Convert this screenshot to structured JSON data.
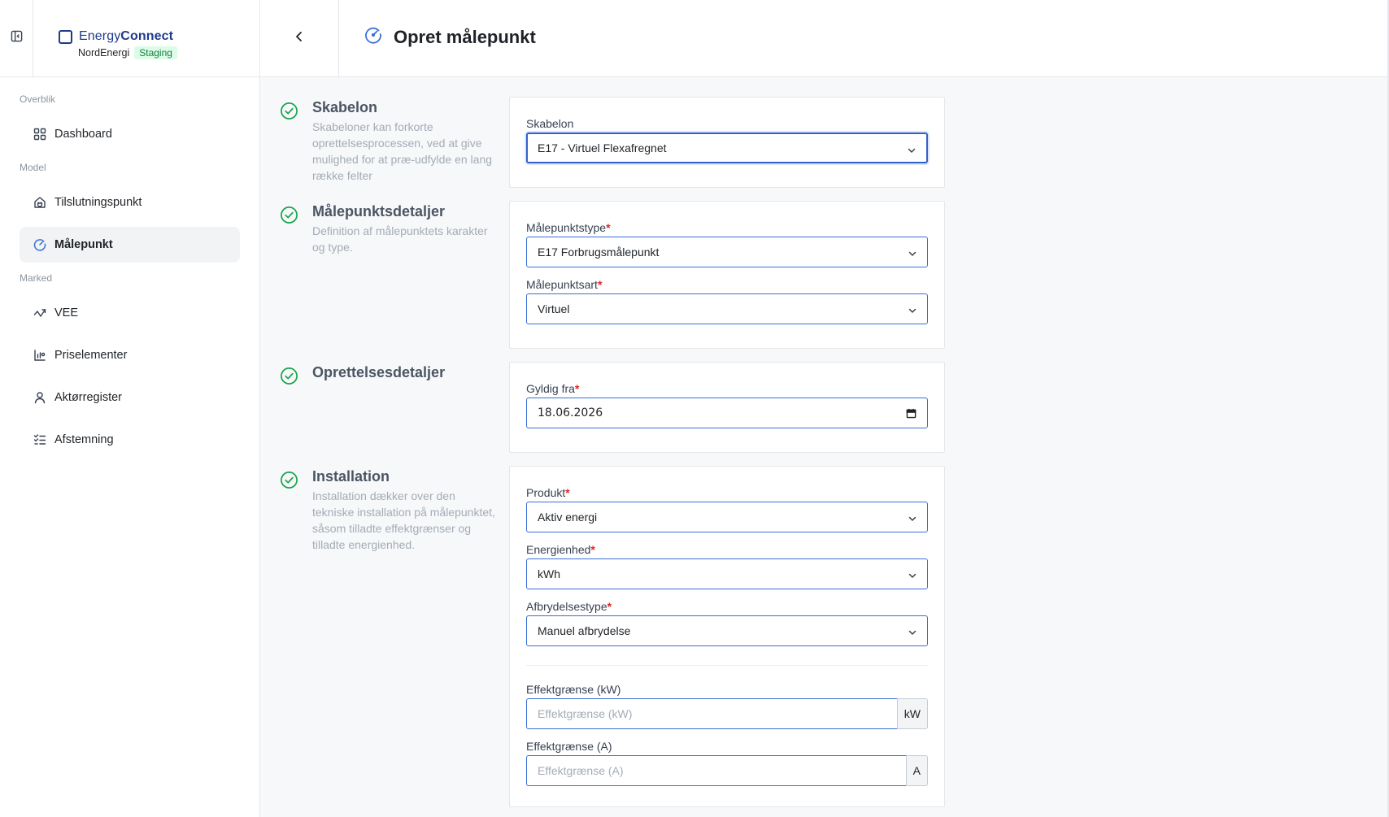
{
  "header": {
    "brand_light": "Energy",
    "brand_bold": "Connect",
    "org": "NordEnergi",
    "env_badge": "Staging",
    "page_title": "Opret målepunkt"
  },
  "sidebar": {
    "sections": [
      {
        "label": "Overblik"
      },
      {
        "label": "Model"
      },
      {
        "label": "Marked"
      }
    ],
    "items": [
      {
        "label": "Dashboard",
        "icon": "grid-icon"
      },
      {
        "label": "Tilslutningspunkt",
        "icon": "house-plug-icon"
      },
      {
        "label": "Målepunkt",
        "icon": "gauge-icon",
        "active": true
      },
      {
        "label": "VEE",
        "icon": "trend-icon"
      },
      {
        "label": "Priselementer",
        "icon": "price-chart-icon"
      },
      {
        "label": "Aktørregister",
        "icon": "user-icon"
      },
      {
        "label": "Afstemning",
        "icon": "list-check-icon"
      }
    ]
  },
  "sections": {
    "skabelon": {
      "title": "Skabelon",
      "desc": "Skabeloner kan forkorte oprettelsesprocessen, ved at give mulighed for at præ-udfylde en lang række felter"
    },
    "detaljer": {
      "title": "Målepunktsdetaljer",
      "desc": "Definition af målepunktets karakter og type."
    },
    "oprettelse": {
      "title": "Oprettelsesdetaljer"
    },
    "installation": {
      "title": "Installation",
      "desc": "Installation dækker over den tekniske installation på målepunktet, såsom tilladte effektgrænser og tilladte energienhed."
    }
  },
  "form": {
    "skabelon": {
      "label": "Skabelon",
      "value": "E17 - Virtuel Flexafregnet"
    },
    "malepunktstype": {
      "label": "Målepunktstype",
      "value": "E17 Forbrugsmålepunkt"
    },
    "malepunktsart": {
      "label": "Målepunktsart",
      "value": "Virtuel"
    },
    "gyldig_fra": {
      "label": "Gyldig fra",
      "value": "18.06.2026"
    },
    "produkt": {
      "label": "Produkt",
      "value": "Aktiv energi"
    },
    "energienhed": {
      "label": "Energienhed",
      "value": "kWh"
    },
    "afbrydelsestype": {
      "label": "Afbrydelsestype",
      "value": "Manuel afbrydelse"
    },
    "effekt_kw": {
      "label": "Effektgrænse (kW)",
      "placeholder": "Effektgrænse (kW)",
      "unit": "kW"
    },
    "effekt_a": {
      "label": "Effektgrænse (A)",
      "placeholder": "Effektgrænse (A)",
      "unit": "A"
    },
    "required_mark": "*"
  },
  "colors": {
    "brand": "#1e3a8a",
    "accent": "#3b6fd6",
    "success": "#16a34a",
    "required": "#dc2626"
  }
}
